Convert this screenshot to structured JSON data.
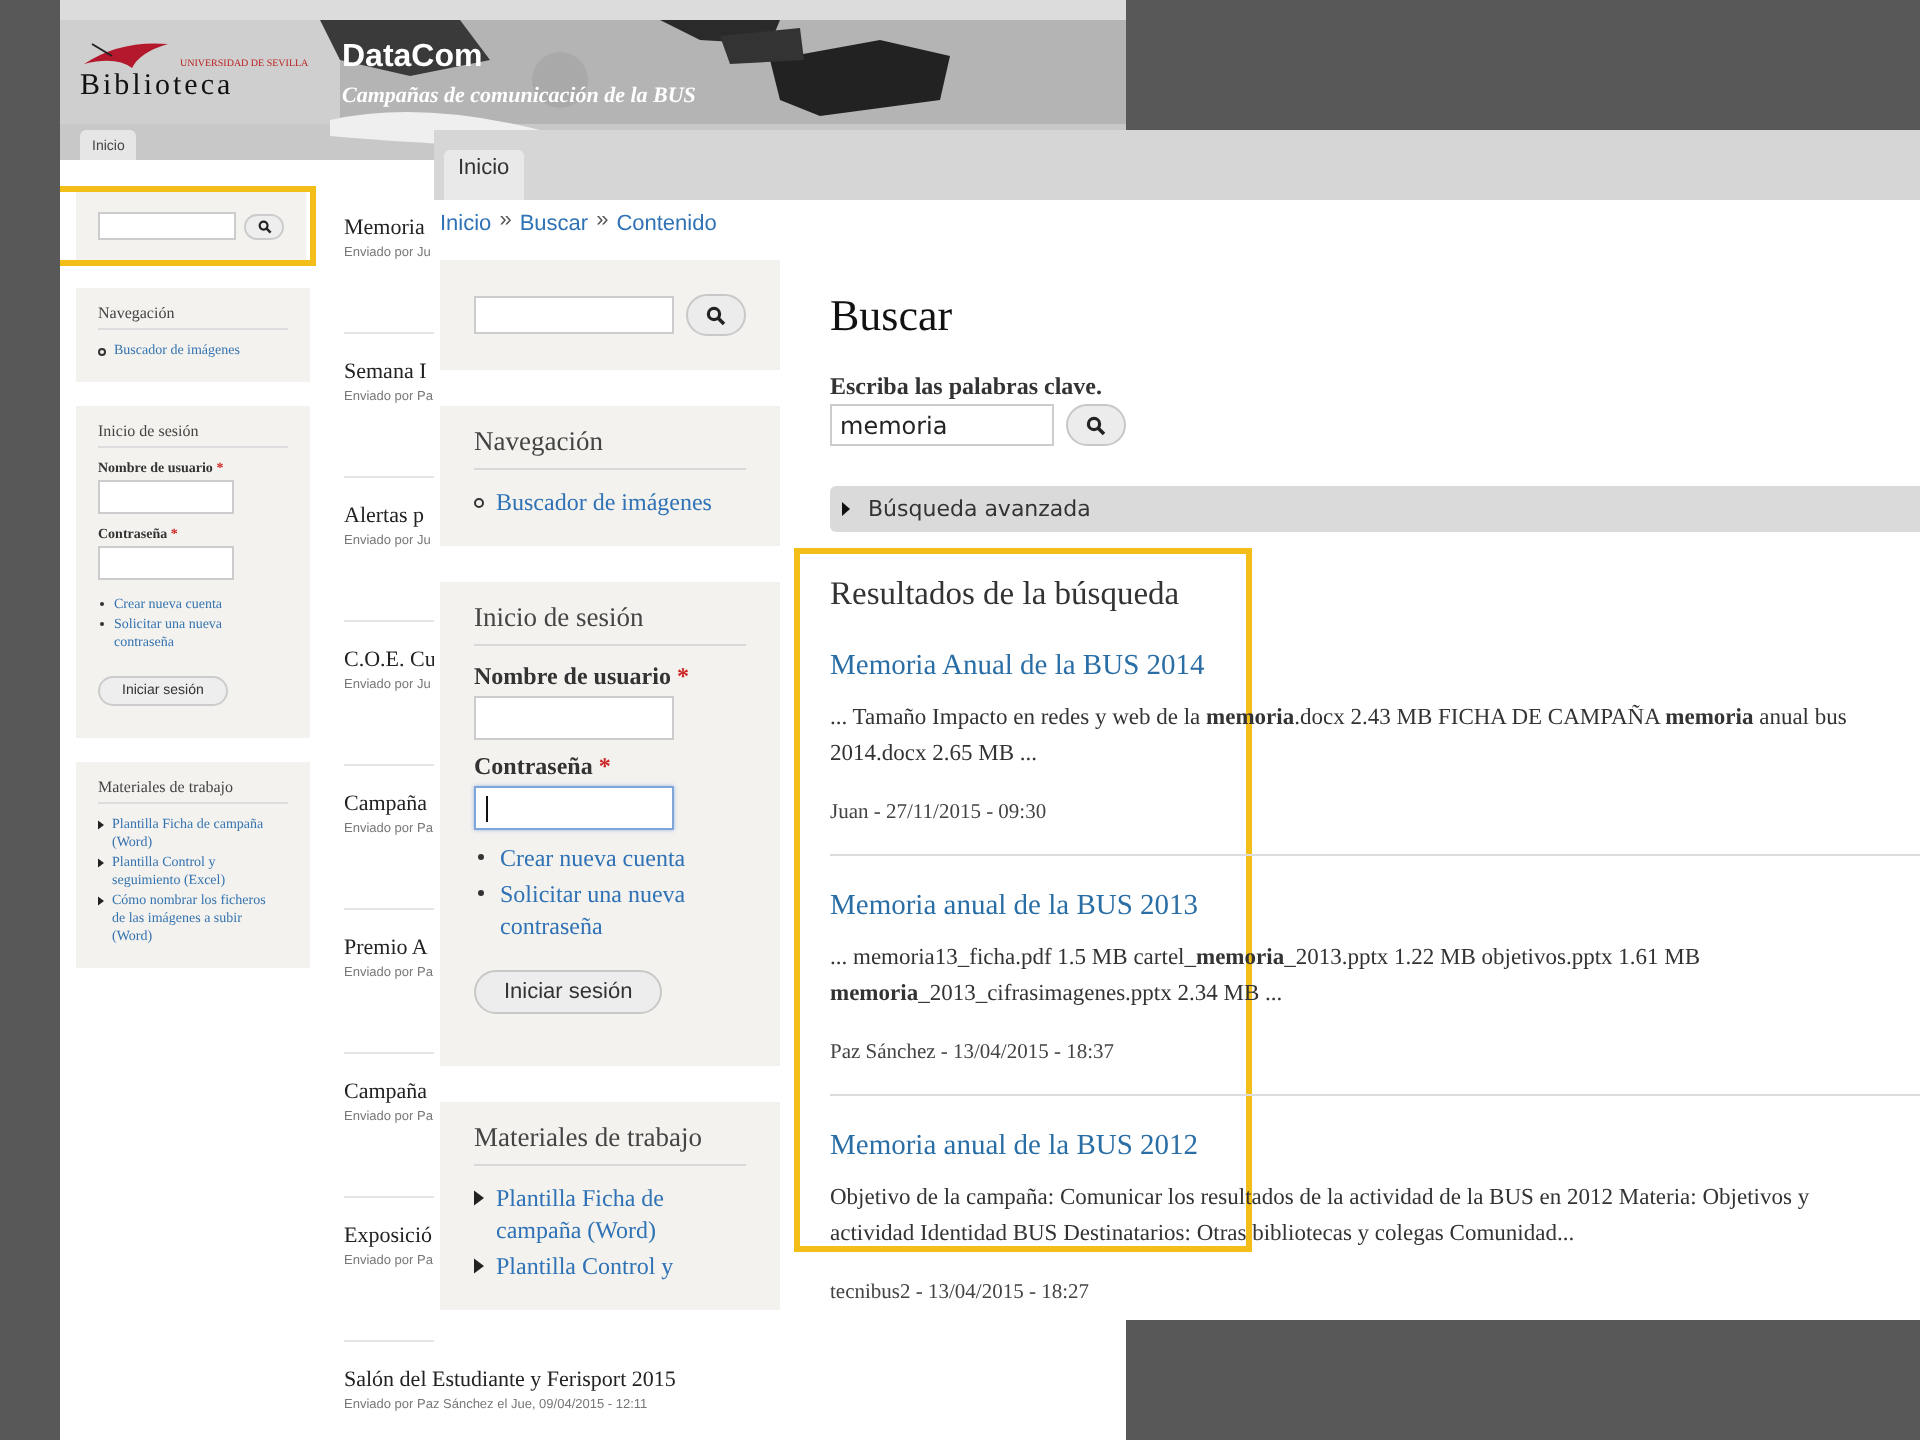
{
  "back_page": {
    "header": {
      "logo_caption": "UNIVERSIDAD DE SEVILLA",
      "logo_text": "Biblioteca",
      "site_name": "DataCom",
      "slogan": "Campañas de comunicación de la BUS"
    },
    "tabs": [
      {
        "label": "Inicio",
        "selected": true
      }
    ],
    "search": {
      "highlighted": true
    },
    "navigation": {
      "title": "Navegación",
      "items": [
        "Buscador de imágenes"
      ]
    },
    "login": {
      "title": "Inicio de sesión",
      "fields": [
        {
          "label": "Nombre de usuario",
          "required_mark": "*",
          "focused": false
        },
        {
          "label": "Contraseña",
          "required_mark": "*",
          "focused": false
        }
      ],
      "links": [
        "Crear nueva cuenta",
        "Solicitar una nueva contraseña"
      ],
      "button": "Iniciar sesión"
    },
    "materials": {
      "title": "Materiales de trabajo",
      "items": [
        "Plantilla Ficha de campaña (Word)",
        "Plantilla Control y seguimiento (Excel)",
        "Cómo nombrar los ficheros de las imágenes a subir (Word)"
      ]
    },
    "articles": [
      {
        "title": "Memoria",
        "byline": "Enviado por Ju"
      },
      {
        "title": "Semana I",
        "byline": "Enviado por Pa"
      },
      {
        "title": "Alertas p",
        "byline": "Enviado por Ju"
      },
      {
        "title": "C.O.E. Cu",
        "byline": "Enviado por Ju"
      },
      {
        "title": "Campaña",
        "byline": "Enviado por Pa"
      },
      {
        "title": "Premio A",
        "byline": "Enviado por Pa"
      },
      {
        "title": "Campaña",
        "byline": "Enviado por Pa"
      },
      {
        "title": "Exposició",
        "byline": "Enviado por Pa"
      },
      {
        "title": "Salón del Estudiante y Ferisport 2015",
        "byline": "Enviado por Paz Sánchez el Jue, 09/04/2015 - 12:11"
      }
    ]
  },
  "front_page": {
    "tabs": [
      {
        "label": "Inicio",
        "selected": true
      }
    ],
    "breadcrumb": {
      "items": [
        "Inicio",
        "Buscar",
        "Contenido"
      ],
      "separator": "»"
    },
    "navigation": {
      "title": "Navegación",
      "items": [
        "Buscador de imágenes"
      ]
    },
    "login": {
      "title": "Inicio de sesión",
      "fields": [
        {
          "label": "Nombre de usuario",
          "required_mark": "*",
          "focused": false
        },
        {
          "label": "Contraseña",
          "required_mark": "*",
          "focused": true
        }
      ],
      "links": [
        "Crear nueva cuenta",
        "Solicitar una nueva contraseña"
      ],
      "button": "Iniciar sesión"
    },
    "materials": {
      "title": "Materiales de trabajo",
      "items": [
        "Plantilla Ficha de campaña (Word)",
        "Plantilla Control y"
      ]
    },
    "search_form": {
      "title": "Buscar",
      "label": "Escriba las palabras clave.",
      "value": "memoria",
      "advanced": {
        "label": "Búsqueda avanzada",
        "expanded": false
      }
    },
    "results": {
      "title": "Resultados de la búsqueda",
      "highlighted": true,
      "items": [
        {
          "title": "Memoria Anual de la BUS 2014",
          "snippet": "... Tamaño Impacto en redes y web de la **memoria**.docx 2.43 MB FICHA DE CAMPAÑA **memoria** anual bus 2014.docx 2.65 MB ...",
          "meta": "Juan - 27/11/2015 - 09:30"
        },
        {
          "title": "Memoria anual de la BUS 2013",
          "snippet": "... memoria13_ficha.pdf 1.5 MB cartel_**memoria**_2013.pptx 1.22 MB objetivos.pptx 1.61 MB **memoria**_2013_cifrasimagenes.pptx 2.34 MB ...",
          "meta": "Paz Sánchez - 13/04/2015 - 18:37"
        },
        {
          "title": "Memoria anual de la BUS 2012",
          "snippet": "Objetivo de la campaña:  Comunicar los resultados de la actividad de la BUS en 2012 Materia: Objetivos y actividad Identidad BUS Destinatarios: Otras bibliotecas y colegas Comunidad...",
          "meta": "tecnibus2 - 13/04/2015 - 18:27"
        }
      ]
    }
  }
}
